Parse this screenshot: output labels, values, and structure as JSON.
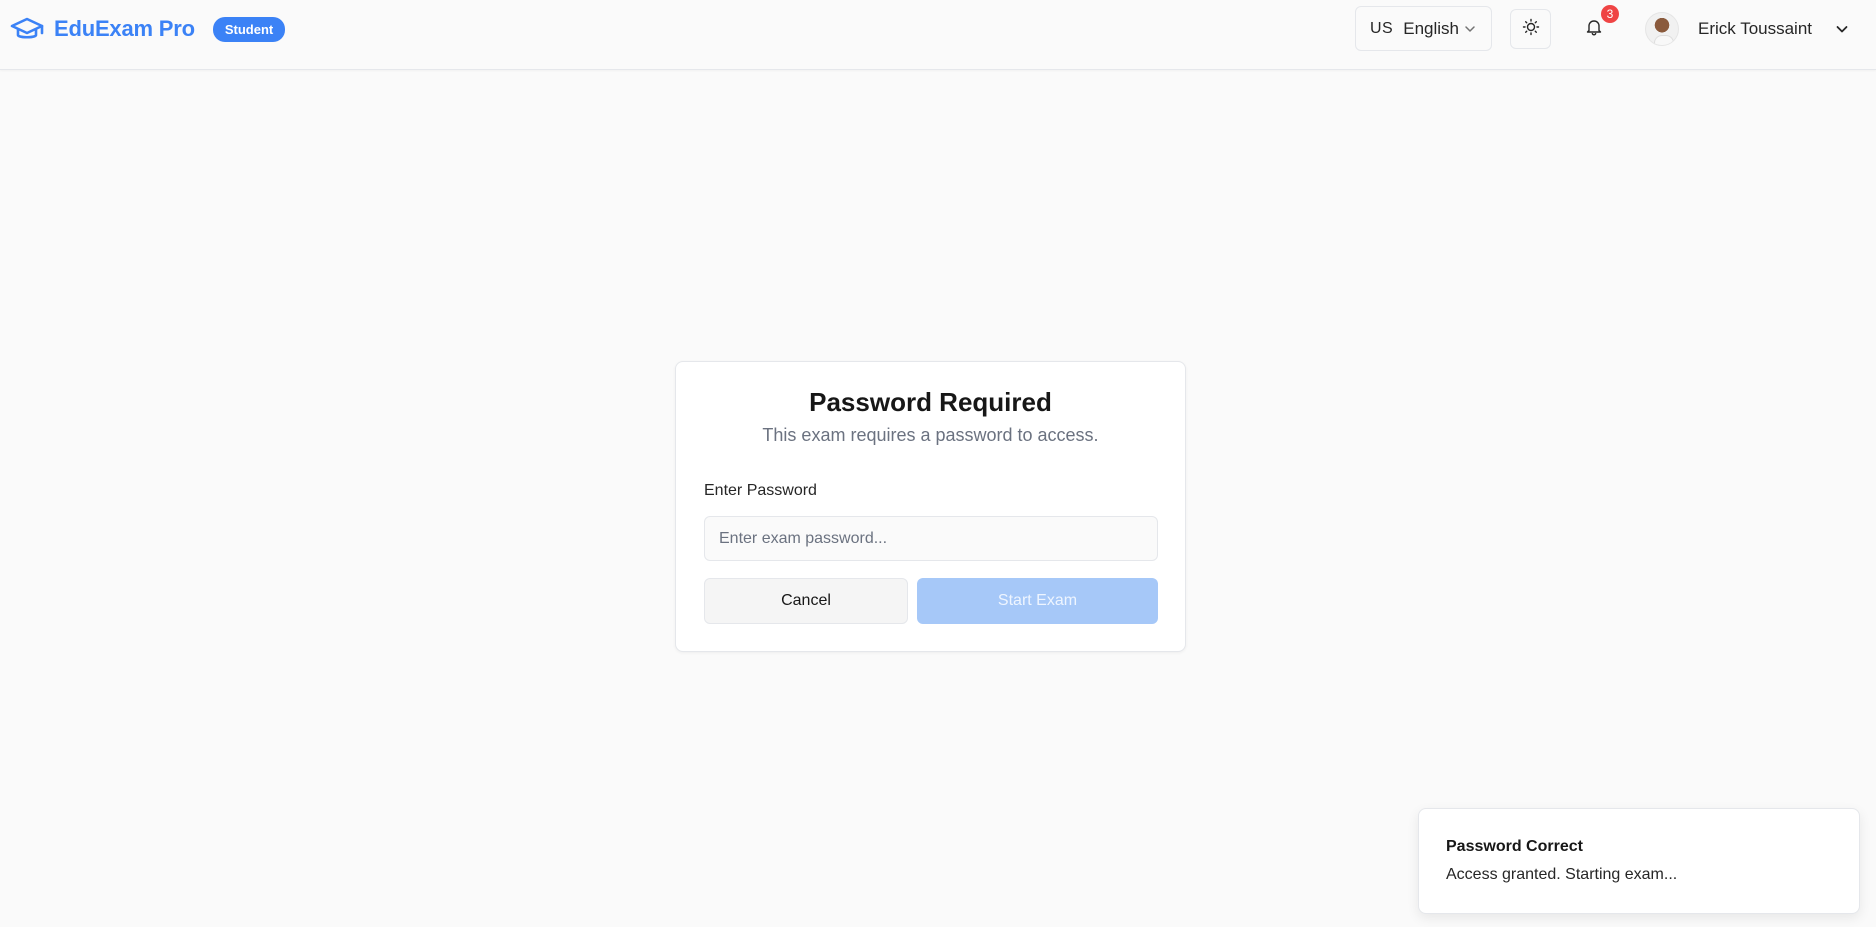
{
  "header": {
    "brand_name": "EduExam Pro",
    "brand_icon": "graduation-cap-icon",
    "role_badge": "Student",
    "language": {
      "flag": "US",
      "label": "English"
    },
    "notifications_count": "3",
    "user_name": "Erick Toussaint"
  },
  "dialog": {
    "title": "Password Required",
    "subtitle": "This exam requires a password to access.",
    "field_label": "Enter Password",
    "input_value": "",
    "input_placeholder": "Enter exam password...",
    "cancel_label": "Cancel",
    "start_label": "Start Exam"
  },
  "toast": {
    "title": "Password Correct",
    "message": "Access granted. Starting exam..."
  },
  "colors": {
    "accent": "#3b82f6",
    "start_disabled": "#a6c8f8",
    "badge_red": "#ef4444",
    "background": "#fafafa"
  }
}
